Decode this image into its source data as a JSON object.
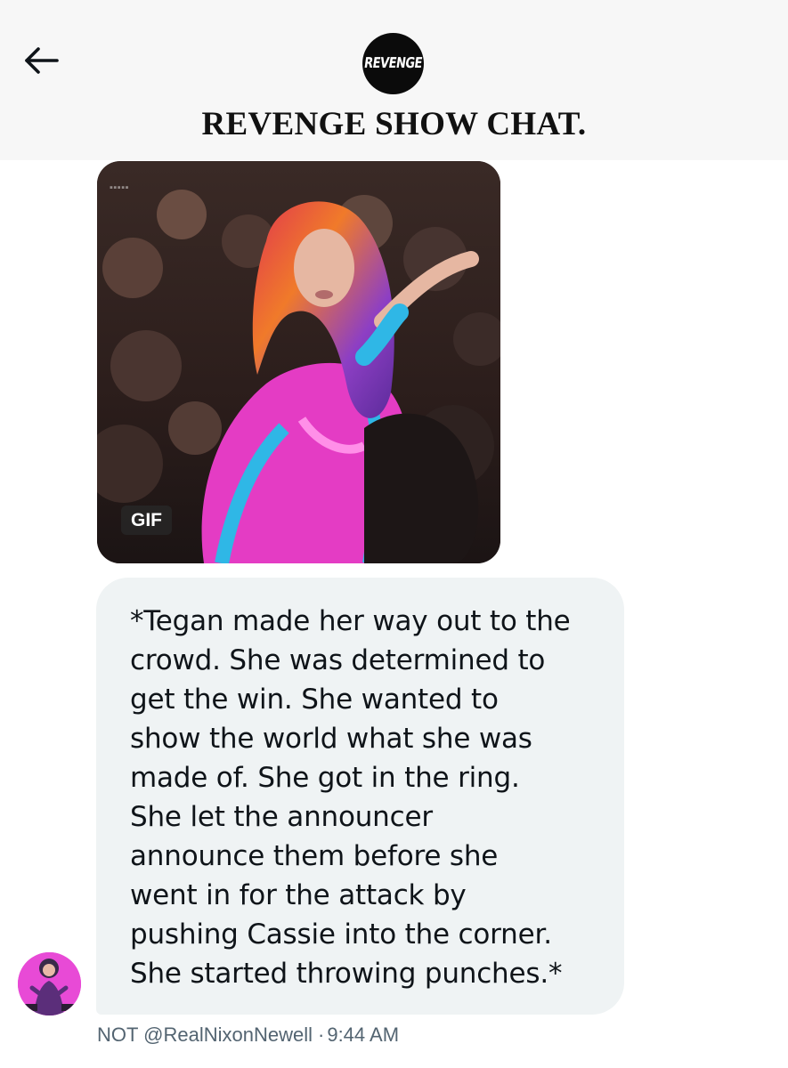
{
  "header": {
    "back_icon": "arrow-left-icon",
    "logo_text": "REVENGE",
    "title": "REVENGE SHOW CHAT."
  },
  "media": {
    "type": "gif",
    "badge": "GIF"
  },
  "message": {
    "text": "*Tegan made her way out to the\ncrowd. She was determined to\nget the win. She wanted to\nshow the world what she was\nmade of. She got in the ring.\nShe let the announcer\nannounce them before she\nwent in for the attack by\npushing Cassie into the corner.\nShe started throwing punches.*",
    "sender": "NOT @RealNixonNewell",
    "separator": "·",
    "time": "9:44 AM"
  },
  "colors": {
    "header_bg": "#f7f7f7",
    "bubble_bg": "#eff3f4",
    "meta_text": "#536471",
    "logo_bg": "#0b0b0b"
  }
}
